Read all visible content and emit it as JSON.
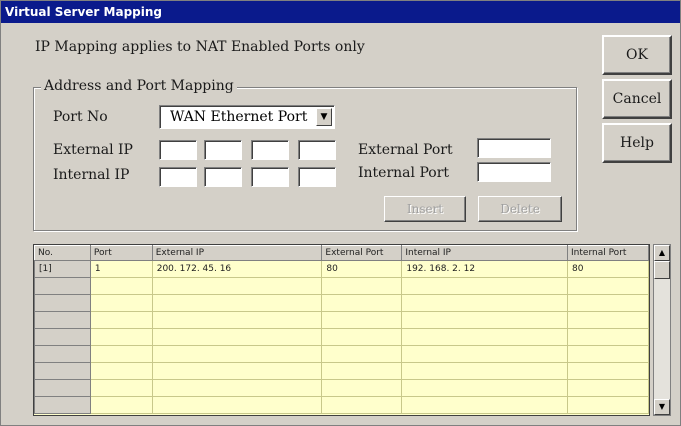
{
  "window": {
    "title": "Virtual Server Mapping"
  },
  "note": "IP Mapping applies to NAT Enabled Ports only",
  "buttons": {
    "ok": "OK",
    "cancel": "Cancel",
    "help": "Help",
    "insert": "Insert",
    "delete": "Delete"
  },
  "group": {
    "legend": "Address and Port Mapping",
    "port_no_label": "Port No",
    "port_no_value": "WAN Ethernet Port",
    "external_ip_label": "External IP",
    "internal_ip_label": "Internal IP",
    "external_port_label": "External Port",
    "internal_port_label": "Internal Port"
  },
  "table": {
    "headers": [
      "No.",
      "Port",
      "External IP",
      "External Port",
      "Internal IP",
      "Internal Port"
    ],
    "rows": [
      [
        "[1]",
        "1",
        "200. 172. 45. 16",
        "80",
        "192. 168. 2. 12",
        "80"
      ],
      [
        "",
        "",
        "",
        "",
        "",
        ""
      ],
      [
        "",
        "",
        "",
        "",
        "",
        ""
      ],
      [
        "",
        "",
        "",
        "",
        "",
        ""
      ],
      [
        "",
        "",
        "",
        "",
        "",
        ""
      ],
      [
        "",
        "",
        "",
        "",
        "",
        ""
      ],
      [
        "",
        "",
        "",
        "",
        "",
        ""
      ],
      [
        "",
        "",
        "",
        "",
        "",
        ""
      ],
      [
        "",
        "",
        "",
        "",
        "",
        ""
      ]
    ]
  },
  "icons": {
    "scroll_up": "scroll-up-arrow-icon",
    "scroll_down": "scroll-down-arrow-icon",
    "dropdown": "chevron-down-icon"
  }
}
